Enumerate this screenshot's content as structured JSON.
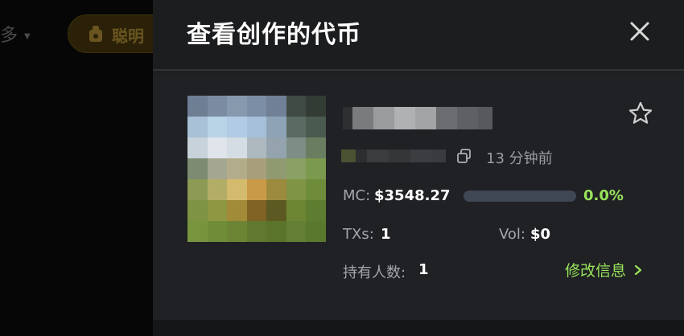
{
  "background": {
    "more_label": "多",
    "pill_label": "聪明"
  },
  "drawer": {
    "title": "查看创作的代币",
    "close_icon": "close-icon"
  },
  "token": {
    "time_ago": "13 分钟前",
    "mc_label": "MC:",
    "mc_value": "$3548.27",
    "progress_pct": 0.0,
    "progress_text": "0.0%",
    "txs_label": "TXs:",
    "txs_value": "1",
    "vol_label": "Vol:",
    "vol_value": "$0",
    "holders_label": "持有人数:",
    "holders_value": "1",
    "edit_label": "修改信息"
  },
  "colors": {
    "accent_green": "#98e35a",
    "drawer_bg": "#1e1f21",
    "progress_track": "#3f4654"
  },
  "icons": {
    "star": "star-icon",
    "copy": "copy-icon",
    "chevron": "chevron-right-icon",
    "pill": "bag-icon"
  }
}
